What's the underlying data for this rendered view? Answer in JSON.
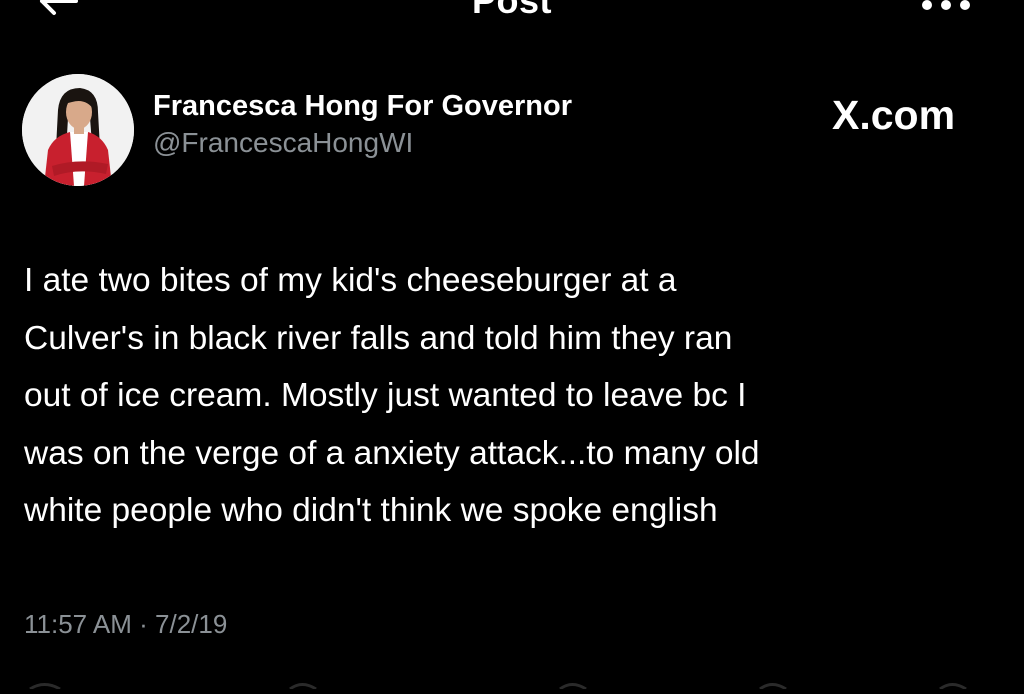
{
  "header": {
    "title": "Post",
    "back_icon": "arrow-left-icon",
    "more_icon": "more-horizontal-icon"
  },
  "tweet": {
    "author": {
      "display_name": "Francesca Hong For Governor",
      "handle": "@FrancescaHongWI",
      "avatar": "profile-photo"
    },
    "source_watermark": "X.com",
    "text_lines": [
      "I ate two bites of my kid's cheeseburger at a",
      "Culver's in black river falls and told him they ran",
      "out of ice cream. Mostly just wanted to leave bc I",
      "was on the verge of a anxiety attack...to many old",
      "white people who didn't think we spoke english"
    ],
    "timestamp": "11:57 AM · 7/2/19"
  },
  "colors": {
    "background": "#000000",
    "text_primary": "#ffffff",
    "text_secondary": "#8b9196",
    "avatar_jacket": "#c8202e"
  }
}
